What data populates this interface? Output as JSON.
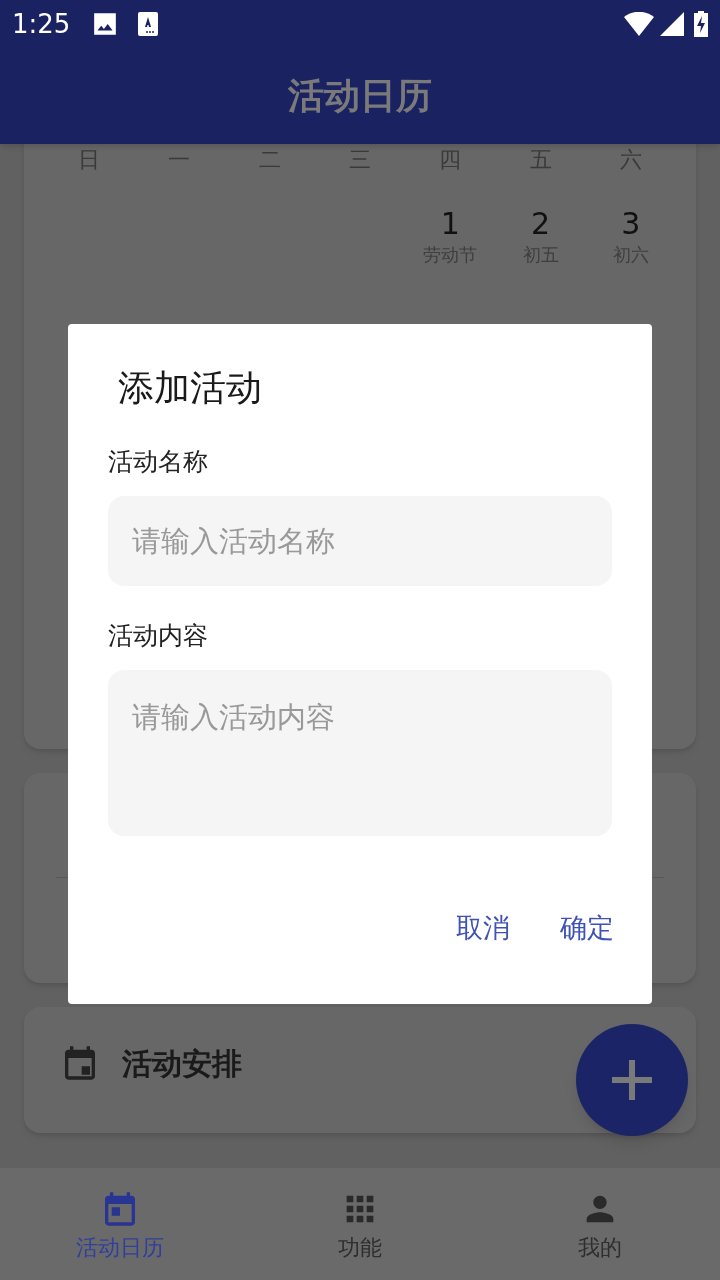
{
  "status_bar": {
    "time": "1:25"
  },
  "app_bar": {
    "title": "活动日历"
  },
  "calendar": {
    "weekdays": [
      "日",
      "一",
      "二",
      "三",
      "四",
      "五",
      "六"
    ],
    "days": [
      {
        "day": "1",
        "lunar": "劳动节"
      },
      {
        "day": "2",
        "lunar": "初五"
      },
      {
        "day": "3",
        "lunar": "初六"
      }
    ]
  },
  "schedule_card": {
    "title": "活动安排"
  },
  "dialog": {
    "title": "添加活动",
    "fields": [
      {
        "label": "活动名称",
        "placeholder": "请输入活动名称",
        "kind": "line"
      },
      {
        "label": "活动内容",
        "placeholder": "请输入活动内容",
        "kind": "area"
      }
    ],
    "buttons": [
      "取消",
      "确定"
    ]
  },
  "bottom_nav": [
    {
      "label": "活动日历",
      "selected": true,
      "kind": "calendar"
    },
    {
      "label": "功能",
      "selected": false,
      "kind": "grid"
    },
    {
      "label": "我的",
      "selected": false,
      "kind": "person"
    }
  ]
}
